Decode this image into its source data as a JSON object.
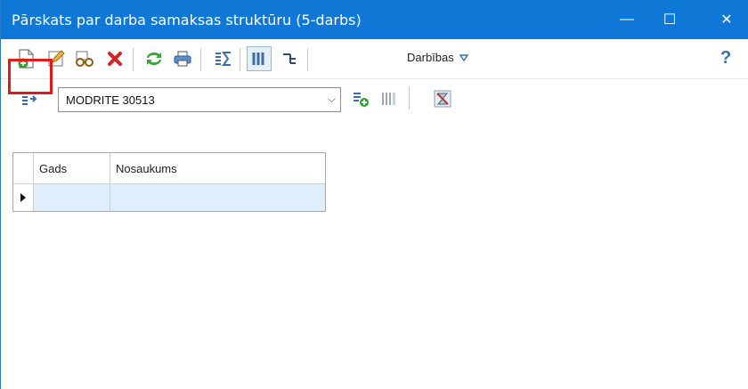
{
  "window": {
    "title": "Pārskats par darba samaksas struktūru (5-darbs)",
    "minimize_glyph": "—",
    "maximize_glyph": "☐",
    "close_glyph": "✕"
  },
  "toolbar": {
    "actions_label": "Darbības",
    "help_glyph": "?"
  },
  "filter": {
    "selected_value": "MODRITE 30513"
  },
  "grid": {
    "columns": [
      "Gads",
      "Nosaukums"
    ],
    "rows": [
      {
        "gads": "",
        "nosaukums": ""
      }
    ]
  },
  "colors": {
    "titlebar": "#0f78d7",
    "selected_row": "#dfeefb",
    "highlight_border": "#e01a1a"
  }
}
